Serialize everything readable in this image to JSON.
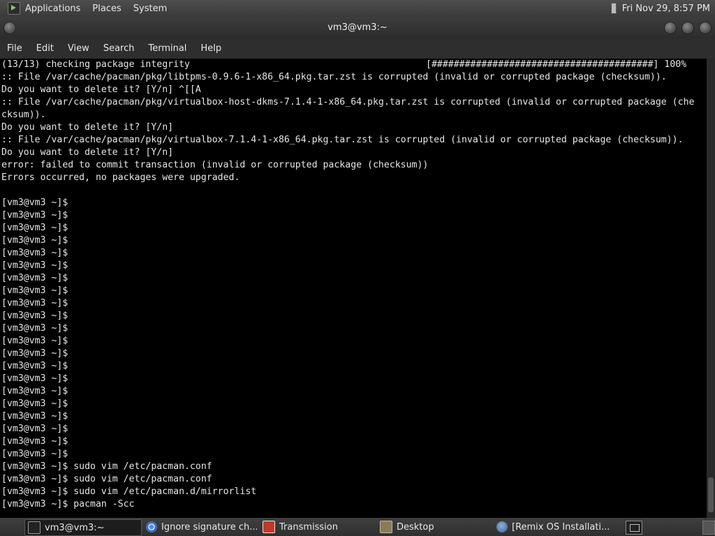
{
  "top_panel": {
    "menus": [
      "Applications",
      "Places",
      "System"
    ],
    "clock": "Fri Nov 29,  8:57 PM"
  },
  "window": {
    "title": "vm3@vm3:~",
    "menu": [
      "File",
      "Edit",
      "View",
      "Search",
      "Terminal",
      "Help"
    ]
  },
  "terminal": {
    "progress_text": "[########################################] 100%",
    "lines": [
      "(13/13) checking package integrity",
      ":: File /var/cache/pacman/pkg/libtpms-0.9.6-1-x86_64.pkg.tar.zst is corrupted (invalid or corrupted package (checksum)).",
      "Do you want to delete it? [Y/n] ^[[A",
      ":: File /var/cache/pacman/pkg/virtualbox-host-dkms-7.1.4-1-x86_64.pkg.tar.zst is corrupted (invalid or corrupted package (che",
      "cksum)).",
      "Do you want to delete it? [Y/n]",
      ":: File /var/cache/pacman/pkg/virtualbox-7.1.4-1-x86_64.pkg.tar.zst is corrupted (invalid or corrupted package (checksum)).",
      "Do you want to delete it? [Y/n]",
      "error: failed to commit transaction (invalid or corrupted package (checksum))",
      "Errors occurred, no packages were upgraded.",
      "",
      "[vm3@vm3 ~]$",
      "[vm3@vm3 ~]$",
      "[vm3@vm3 ~]$",
      "[vm3@vm3 ~]$",
      "[vm3@vm3 ~]$",
      "[vm3@vm3 ~]$",
      "[vm3@vm3 ~]$",
      "[vm3@vm3 ~]$",
      "[vm3@vm3 ~]$",
      "[vm3@vm3 ~]$",
      "[vm3@vm3 ~]$",
      "[vm3@vm3 ~]$",
      "[vm3@vm3 ~]$",
      "[vm3@vm3 ~]$",
      "[vm3@vm3 ~]$",
      "[vm3@vm3 ~]$",
      "[vm3@vm3 ~]$",
      "[vm3@vm3 ~]$",
      "[vm3@vm3 ~]$",
      "[vm3@vm3 ~]$",
      "[vm3@vm3 ~]$",
      "[vm3@vm3 ~]$ sudo vim /etc/pacman.conf",
      "[vm3@vm3 ~]$ sudo vim /etc/pacman.conf",
      "[vm3@vm3 ~]$ sudo vim /etc/pacman.d/mirrorlist",
      "[vm3@vm3 ~]$ pacman -Scc"
    ]
  },
  "taskbar": {
    "tasks": [
      {
        "label": "vm3@vm3:~",
        "icon": "terminal-icon"
      },
      {
        "label": "Ignore signature ch...",
        "icon": "chrome-icon"
      },
      {
        "label": "Transmission",
        "icon": "transmission-icon"
      },
      {
        "label": "Desktop",
        "icon": "folder-icon"
      },
      {
        "label": "[Remix OS Installati...",
        "icon": "remix-os-icon"
      }
    ]
  }
}
